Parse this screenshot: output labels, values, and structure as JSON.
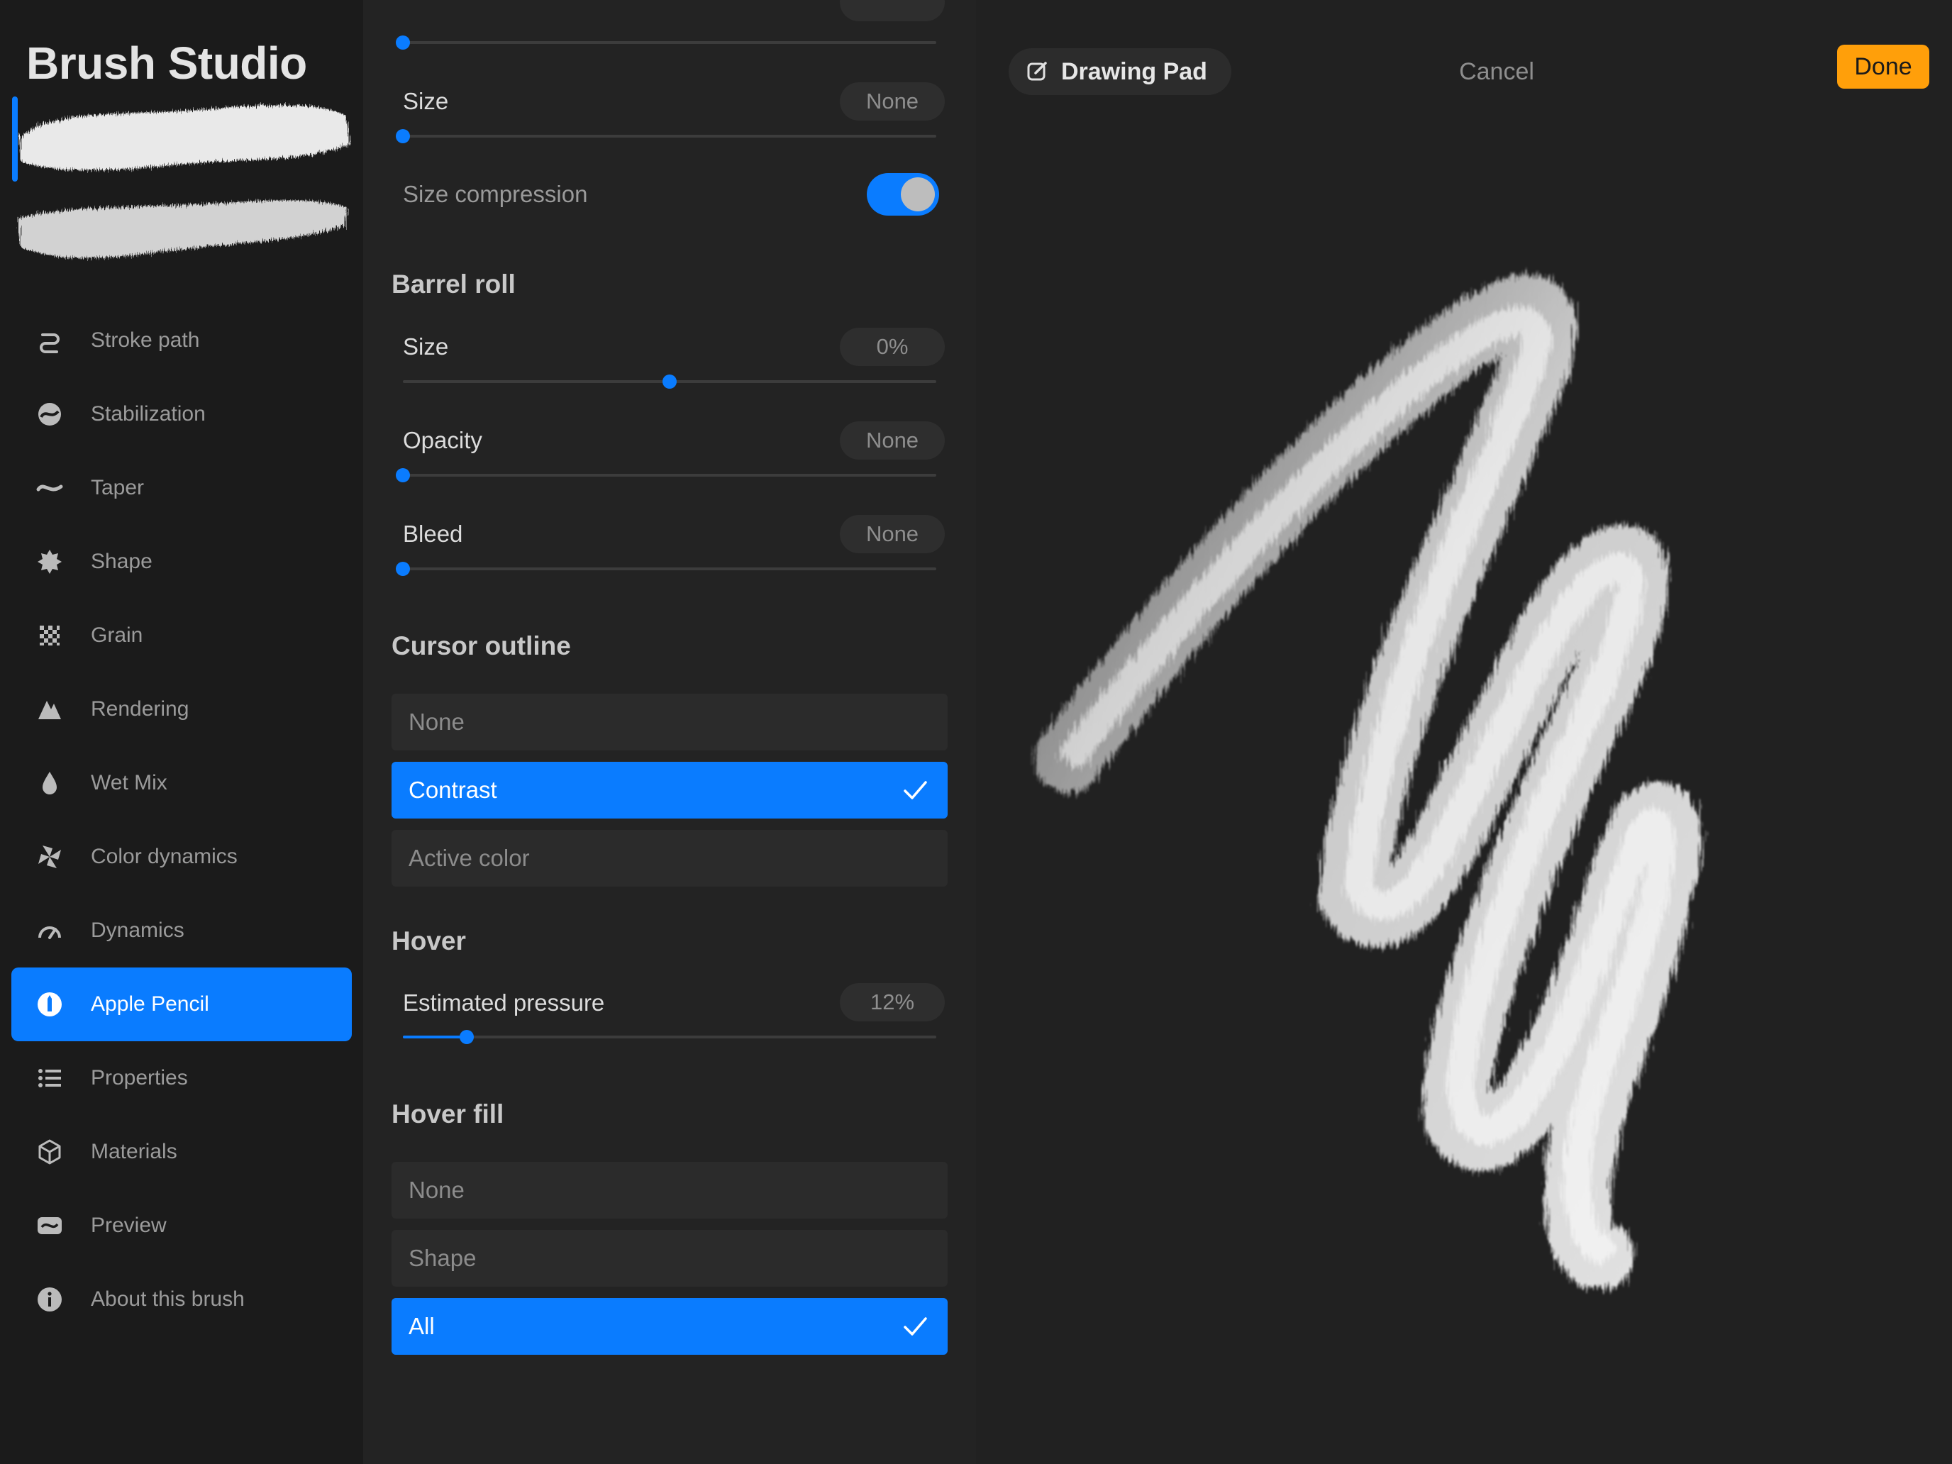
{
  "app": {
    "title": "Brush Studio"
  },
  "sidebar": {
    "items": [
      {
        "label": "Stroke path",
        "icon": "stroke-path-icon"
      },
      {
        "label": "Stabilization",
        "icon": "stabilization-icon"
      },
      {
        "label": "Taper",
        "icon": "taper-icon"
      },
      {
        "label": "Shape",
        "icon": "shape-icon"
      },
      {
        "label": "Grain",
        "icon": "grain-icon"
      },
      {
        "label": "Rendering",
        "icon": "rendering-icon"
      },
      {
        "label": "Wet Mix",
        "icon": "wet-mix-icon"
      },
      {
        "label": "Color dynamics",
        "icon": "color-dynamics-icon"
      },
      {
        "label": "Dynamics",
        "icon": "dynamics-icon"
      },
      {
        "label": "Apple Pencil",
        "icon": "apple-pencil-icon",
        "active": true
      },
      {
        "label": "Properties",
        "icon": "properties-icon"
      },
      {
        "label": "Materials",
        "icon": "materials-icon"
      },
      {
        "label": "Preview",
        "icon": "preview-icon"
      },
      {
        "label": "About this brush",
        "icon": "info-icon"
      }
    ]
  },
  "settings": {
    "top_slider": {
      "value": 0
    },
    "pressure_size": {
      "label": "Size",
      "value": "None",
      "level": 0
    },
    "size_compression": {
      "label": "Size compression",
      "on": true
    },
    "barrel_roll": {
      "title": "Barrel roll",
      "size": {
        "label": "Size",
        "value": "0%",
        "level": 0.5
      },
      "opacity": {
        "label": "Opacity",
        "value": "None",
        "level": 0
      },
      "bleed": {
        "label": "Bleed",
        "value": "None",
        "level": 0
      }
    },
    "cursor_outline": {
      "title": "Cursor outline",
      "options": [
        "None",
        "Contrast",
        "Active color"
      ],
      "selected": "Contrast"
    },
    "hover": {
      "title": "Hover",
      "estimated_pressure": {
        "label": "Estimated pressure",
        "value": "12%",
        "level": 0.12
      }
    },
    "hover_fill": {
      "title": "Hover fill",
      "options": [
        "None",
        "Shape",
        "All"
      ],
      "selected": "All"
    }
  },
  "pad": {
    "badge": "Drawing Pad",
    "cancel_label": "Cancel",
    "done_label": "Done"
  },
  "colors": {
    "accent": "#0a7cff",
    "done": "#ff9f0a"
  }
}
